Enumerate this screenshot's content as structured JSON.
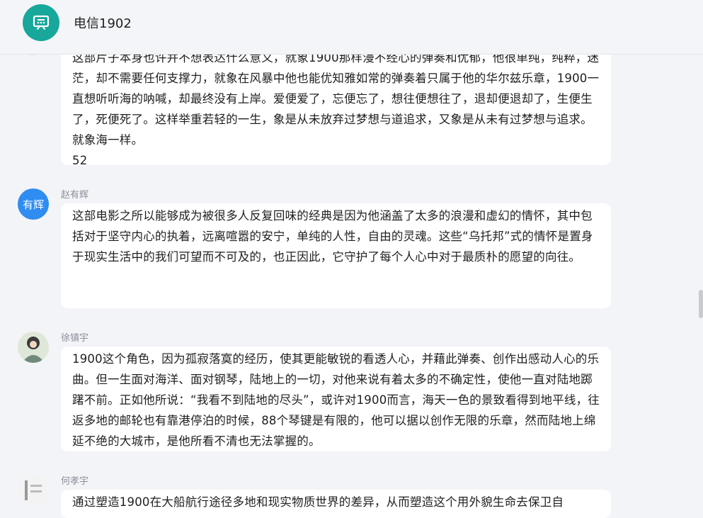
{
  "header": {
    "title": "电信1902",
    "avatar_icon": "presentation-board-icon",
    "accent": "#17a79b"
  },
  "comments": [
    {
      "user": "",
      "text": "这部片子本身也许并不想表达什么意义，就象1900那样漫不经心的弹奏和优郁，他很单纯，纯粹，迷茫，却不需要任何支撑力，就象在风暴中他也能优知雅如常的弹奏着只属于他的华尔兹乐章，1900一直想听听海的呐喊，却最终没有上岸。爱便爱了，忘便忘了，想往便想往了，退却便退却了，生便生了，死便死了。这样举重若轻的一生，象是从未放弃过梦想与道追求，又象是从未有过梦想与追求。就象海一样。",
      "count": "52"
    },
    {
      "user": "赵有辉",
      "avatar_text": "有辉",
      "text": "这部电影之所以能够成为被很多人反复回味的经典是因为他涵盖了太多的浪漫和虚幻的情怀，其中包括对于坚守内心的执着，远离喧嚣的安宁，单纯的人性，自由的灵魂。这些“乌托邦”式的情怀是置身于现实生活中的我们可望而不可及的，也正因此，它守护了每个人心中对于最质朴的愿望的向往。"
    },
    {
      "user": "徐镇宇",
      "text": "1900这个角色，因为孤寂落寞的经历，使其更能敏锐的看透人心，并藉此弹奏、创作出感动人心的乐曲。但一生面对海洋、面对钢琴，陆地上的一切，对他来说有着太多的不确定性，使他一直对陆地踯躇不前。正如他所说：“我看不到陆地的尽头”，或许对1900而言，海天一色的景致看得到地平线，往返多地的邮轮也有靠港停泊的时候，88个琴键是有限的，他可以据以创作无限的乐章，然而陆地上绵延不绝的大城市，是他所看不清也无法掌握的。"
    },
    {
      "user": "何孝宇",
      "text": "通过塑造1900在大船航行途径多地和现实物质世界的差异，从而塑造这个用外貌生命去保卫自"
    }
  ]
}
